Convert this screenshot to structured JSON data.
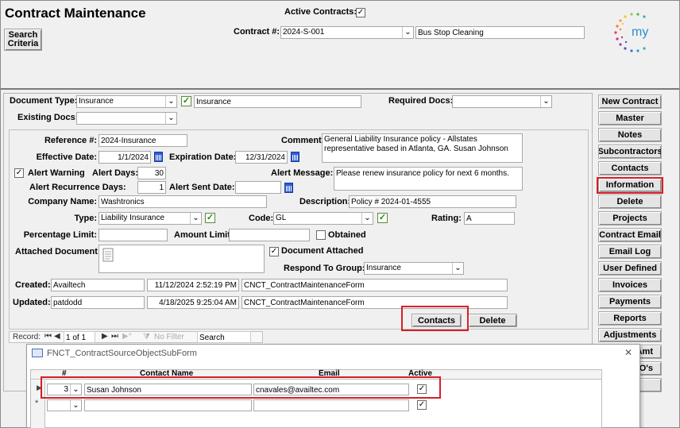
{
  "header": {
    "title": "Contract Maintenance",
    "search_criteria": "Search\nCriteria",
    "active_contracts_label": "Active Contracts:",
    "active_contracts_checked": "✓",
    "contract_num_label": "Contract #:",
    "contract_num_value": "2024-S-001",
    "contract_desc": "Bus Stop Cleaning",
    "logo_text": "my"
  },
  "doc": {
    "doc_type_label": "Document Type:",
    "doc_type_value": "Insurance",
    "doc_type_desc": "Insurance",
    "required_docs_label": "Required Docs:",
    "existing_docs_label": "Existing Docs:",
    "reference_label": "Reference #:",
    "reference_value": "2024-Insurance",
    "comment_label": "Comment:",
    "comment_value": "General Liability Insurance policy - Allstates representative based in Atlanta, GA.  Susan Johnson",
    "effective_label": "Effective Date:",
    "effective_value": "1/1/2024",
    "expiration_label": "Expiration Date:",
    "expiration_value": "12/31/2024",
    "alert_warning_label": "Alert Warning",
    "alert_days_label": "Alert Days:",
    "alert_days_value": "30",
    "alert_message_label": "Alert Message:",
    "alert_message_value": "Please renew insurance policy for next 6 months.",
    "alert_recurrence_label": "Alert Recurrence Days:",
    "alert_recurrence_value": "1",
    "alert_sent_label": "Alert Sent Date:",
    "company_label": "Company Name:",
    "company_value": "Washtronics",
    "description_label": "Description:",
    "description_value": "Policy # 2024-01-4555",
    "type_label": "Type:",
    "type_value": "Liability Insurance",
    "code_label": "Code:",
    "code_value": "GL",
    "rating_label": "Rating:",
    "rating_value": "A",
    "pct_limit_label": "Percentage Limit:",
    "amount_limit_label": "Amount Limit:",
    "obtained_label": "Obtained",
    "attached_doc_label": "Attached Document:",
    "doc_attached_label": "Document Attached",
    "respond_group_label": "Respond To Group:",
    "respond_group_value": "Insurance",
    "created_label": "Created:",
    "created_user": "Availtech",
    "created_date": "11/12/2024 2:52:19 PM",
    "created_form": "CNCT_ContractMaintenanceForm",
    "updated_label": "Updated:",
    "updated_user": "patdodd",
    "updated_date": "4/18/2025 9:25:04 AM",
    "updated_form": "CNCT_ContractMaintenanceForm",
    "contacts_btn": "Contacts",
    "delete_btn": "Delete",
    "record_label": "Record:",
    "record_value": "1 of 1",
    "no_filter": "No Filter",
    "search": "Search"
  },
  "sidebar": [
    "New Contract",
    "Master",
    "Notes",
    "Subcontractors",
    "Contacts",
    "Information",
    "Delete",
    "Projects",
    "Contract Email",
    "Email Log",
    "User Defined",
    "Invoices",
    "Payments",
    "Reports",
    "Adjustments",
    "Amt",
    "O's"
  ],
  "subform": {
    "title": "FNCT_ContractSourceObjectSubForm",
    "close": "✕",
    "col_num": "#",
    "col_name": "Contact Name",
    "col_email": "Email",
    "col_active": "Active",
    "row_num": "3",
    "row_name": "Susan Johnson",
    "row_email": "cnavales@availtec.com",
    "row_active": "✓",
    "new_active": "✓"
  },
  "colors": {
    "highlight": "#d61f26",
    "check_green": "#1e8c1e"
  }
}
